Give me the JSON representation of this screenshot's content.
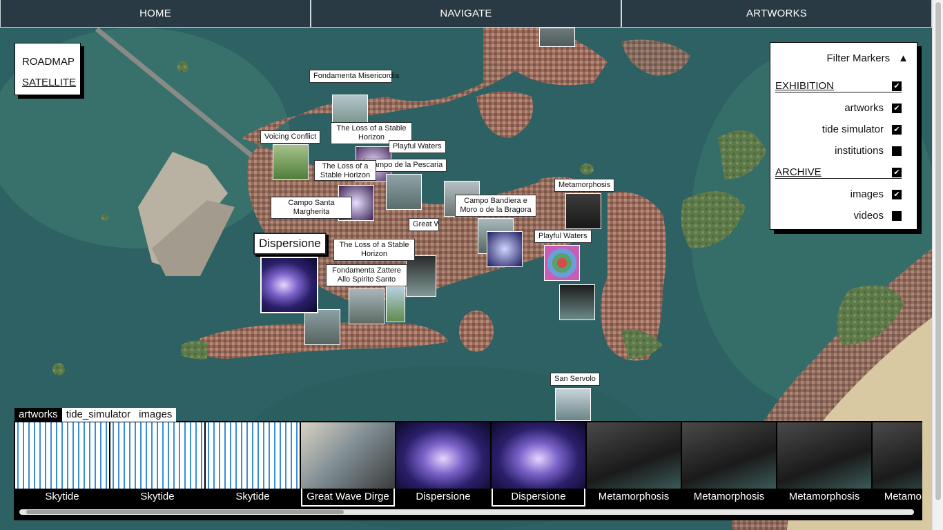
{
  "nav": {
    "home": "HOME",
    "navigate": "NAVIGATE",
    "artworks": "ARTWORKS"
  },
  "map_type": {
    "roadmap": "ROADMAP",
    "satellite": "SATELLITE",
    "selected": "SATELLITE"
  },
  "filter": {
    "title": "Filter Markers",
    "toggle_icon": "▲",
    "groups": [
      {
        "label": "EXHIBITION",
        "checked": true,
        "items": [
          {
            "label": "artworks",
            "checked": true
          },
          {
            "label": "tide simulator",
            "checked": true
          },
          {
            "label": "institutions",
            "checked": false
          }
        ]
      },
      {
        "label": "ARCHIVE",
        "checked": true,
        "items": [
          {
            "label": "images",
            "checked": true
          },
          {
            "label": "videos",
            "checked": false
          }
        ]
      }
    ],
    "check_glyph": "✔"
  },
  "markers": [
    "Fondamenta Misericordia",
    "Voicing Conflict",
    "The Loss of a Stable Horizon",
    "Playful Waters",
    "Campo de la Pescaria",
    "The Loss of a Stable Horizon",
    "Campo Santa Margherita",
    "Dispersione",
    "The Loss of a Stable Horizon",
    "Fondamenta Zattere Allo Spirito Santo",
    "Campo Bandiera e Moro o de la Bragora",
    "Metamorphosis",
    "Playful Waters",
    "San Servolo",
    "Great Wave Dirge"
  ],
  "gallery": {
    "tabs": [
      "artworks",
      "tide_simulator",
      "images"
    ],
    "active_tab": "artworks",
    "items": [
      "Skytide",
      "Skytide",
      "Skytide",
      "Great Wave Dirge",
      "Dispersione",
      "Dispersione",
      "Metamorphosis",
      "Metamorphosis",
      "Metamorphosis",
      "Metamorphosis"
    ]
  },
  "colors": {
    "nav_bg": "#2a3a44",
    "sea": "#2e6566",
    "panel_bg": "#ffffff"
  }
}
